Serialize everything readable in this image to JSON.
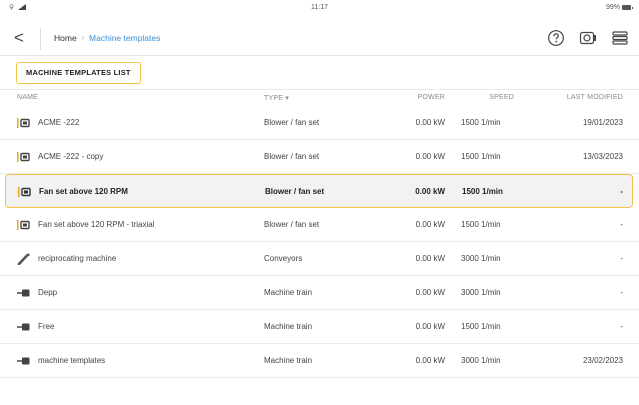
{
  "status_bar": {
    "time": "11:17",
    "battery": "99%"
  },
  "nav": {
    "back_glyph": "<",
    "breadcrumb": {
      "home": "Home",
      "separator": "›",
      "current": "Machine templates"
    },
    "icons": [
      "help-icon",
      "device-icon",
      "menu-icon"
    ]
  },
  "section": {
    "title": "MACHINE TEMPLATES LIST"
  },
  "table": {
    "headers": {
      "name": "NAME",
      "type": "TYPE ▾",
      "power": "POWER",
      "speed": "SPEED",
      "last_modified": "LAST MODIFIED"
    },
    "rows": [
      {
        "icon": "machine-set-icon",
        "name": "ACME -222",
        "type": "Blower / fan set",
        "power": "0.00 kW",
        "speed": "1500 1/min",
        "last_modified": "19/01/2023"
      },
      {
        "icon": "machine-set-icon",
        "name": "ACME -222 - copy",
        "type": "Blower / fan set",
        "power": "0.00 kW",
        "speed": "1500 1/min",
        "last_modified": "13/03/2023"
      },
      {
        "icon": "machine-set-icon",
        "name": "Fan set above 120 RPM",
        "type": "Blower / fan set",
        "power": "0.00 kW",
        "speed": "1500 1/min",
        "last_modified": "-"
      },
      {
        "icon": "machine-set-icon",
        "name": "Fan set above 120 RPM - triaxial",
        "type": "Blower / fan set",
        "power": "0.00 kW",
        "speed": "1500 1/min",
        "last_modified": "-"
      },
      {
        "icon": "reciprocating-icon",
        "name": "reciprocating machine",
        "type": "Conveyors",
        "power": "0.00 kW",
        "speed": "3000 1/min",
        "last_modified": "-"
      },
      {
        "icon": "machine-train-icon",
        "name": "Depp",
        "type": "Machine train",
        "power": "0.00 kW",
        "speed": "3000 1/min",
        "last_modified": "-"
      },
      {
        "icon": "machine-train-icon",
        "name": "Free",
        "type": "Machine train",
        "power": "0.00 kW",
        "speed": "1500 1/min",
        "last_modified": "-"
      },
      {
        "icon": "machine-train-icon",
        "name": "machine templates",
        "type": "Machine train",
        "power": "0.00 kW",
        "speed": "3000 1/min",
        "last_modified": "23/02/2023"
      }
    ],
    "selected_index": 2
  },
  "colors": {
    "accent": "#f3c24a",
    "link": "#3b8fd6",
    "selected_bg": "#f2f2f2"
  }
}
